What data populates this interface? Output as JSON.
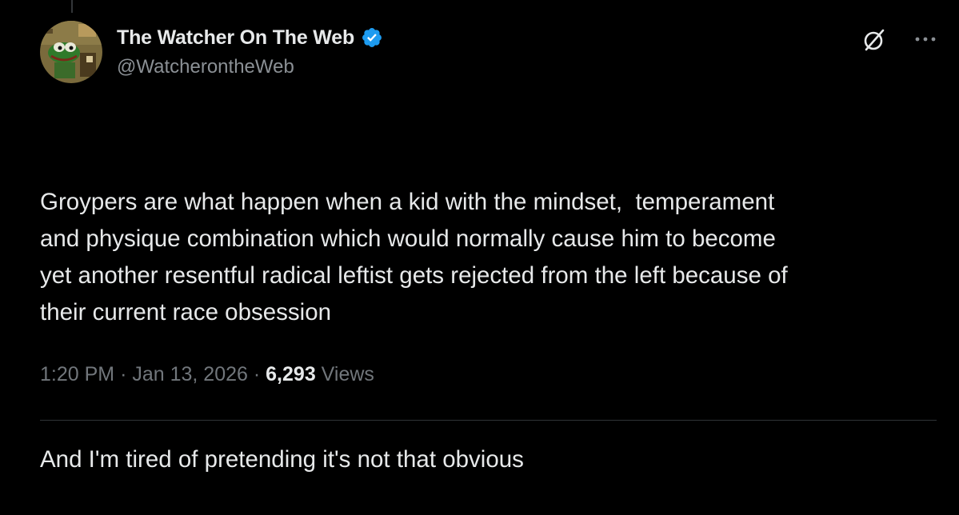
{
  "author": {
    "display_name": "The Watcher On The Web",
    "handle": "@WatcherontheWeb",
    "verified": true,
    "avatar_icon": "green-frog-cartoon-avatar"
  },
  "tweet": {
    "paragraph_1": "Groypers are what happen when a kid with the mindset,  temperament\nand physique combination which would normally cause him to become\nyet another resentful radical leftist gets rejected from the left because of\ntheir current race obsession",
    "paragraph_2": "And I'm tired of pretending it's not that obvious"
  },
  "meta": {
    "time": "1:20 PM",
    "separator": "·",
    "date": "Jan 13, 2026",
    "views_count": "6,293",
    "views_label": "Views"
  },
  "icons": {
    "grok": "grok-slash-circle-icon",
    "more": "more-horizontal-icon",
    "verified": "verified-badge-icon"
  },
  "colors": {
    "background": "#000000",
    "text_primary": "#e7e9ea",
    "text_secondary": "#71767b",
    "verified_blue": "#1d9bf0",
    "divider": "#2f3336"
  }
}
